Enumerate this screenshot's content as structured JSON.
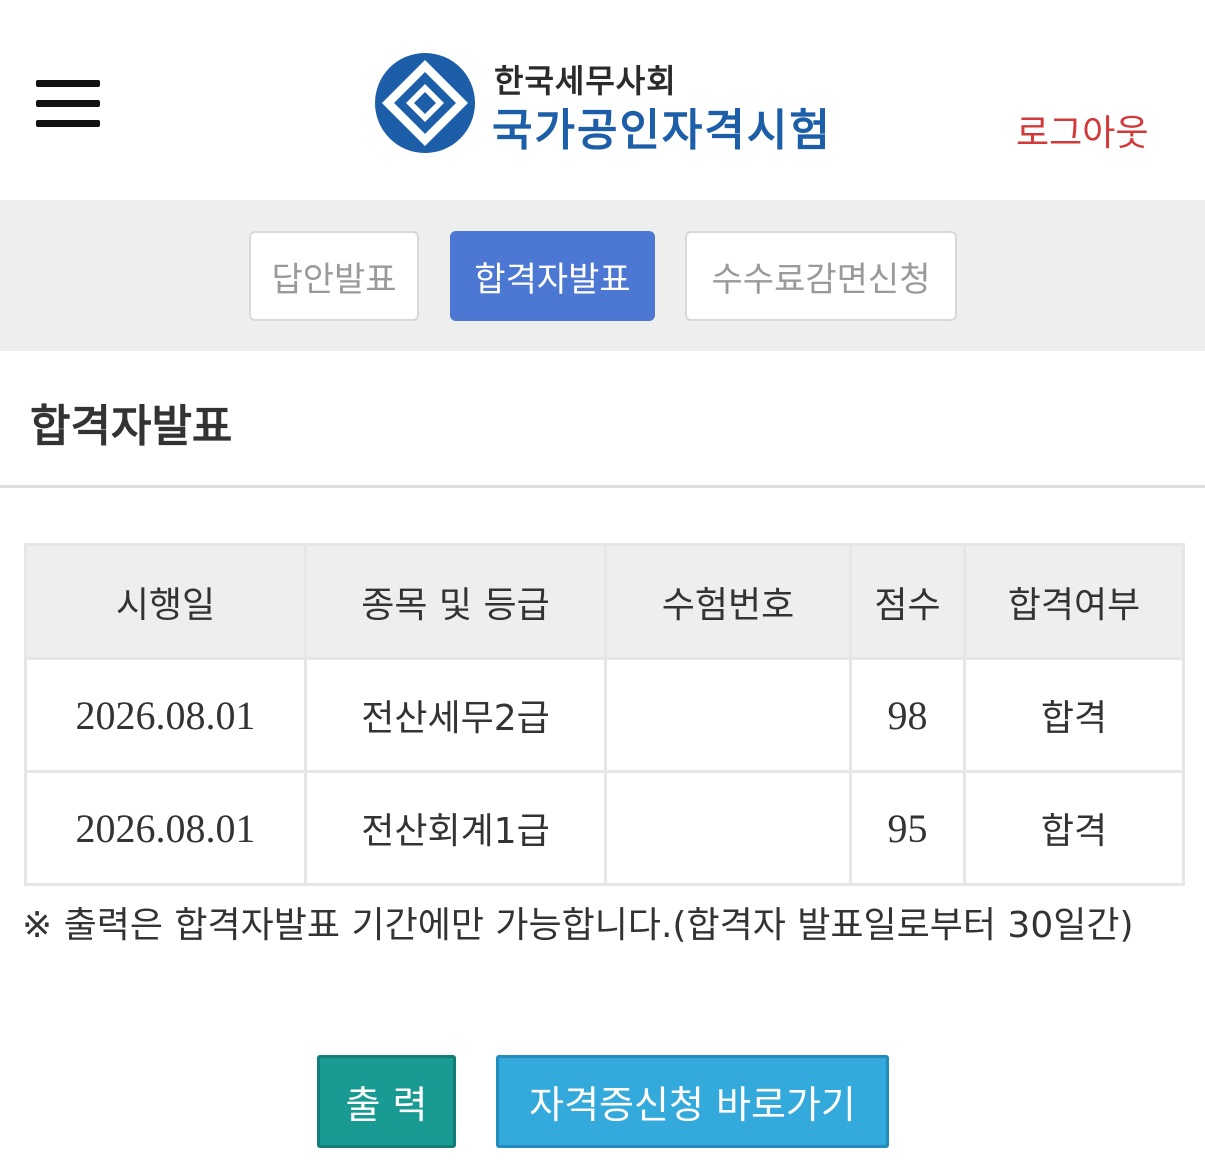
{
  "header": {
    "logo_org": "한국세무사회",
    "logo_title": "국가공인자격시험",
    "logout_label": "로그아웃",
    "menu_icon": "hamburger-menu-icon",
    "logo_icon": "diamond-emblem-icon"
  },
  "tabs": [
    {
      "label": "답안발표",
      "active": false
    },
    {
      "label": "합격자발표",
      "active": true
    },
    {
      "label": "수수료감면신청",
      "active": false
    }
  ],
  "page": {
    "title": "합격자발표"
  },
  "table": {
    "headers": [
      "시행일",
      "종목 및 등급",
      "수험번호",
      "점수",
      "합격여부"
    ],
    "rows": [
      {
        "date": "2026.08.01",
        "subject": "전산세무2급",
        "exam_no": "",
        "score": "98",
        "result": "합격"
      },
      {
        "date": "2026.08.01",
        "subject": "전산회계1급",
        "exam_no": "",
        "score": "95",
        "result": "합격"
      }
    ]
  },
  "notice": "※ 출력은 합격자발표 기간에만 가능합니다.(합격자 발표일로부터 30일간)",
  "buttons": {
    "print_label": "출 력",
    "cert_label": "자격증신청 바로가기"
  },
  "colors": {
    "brand_blue": "#1d5ea8",
    "active_tab": "#4c77d2",
    "logout_red": "#d23a3a",
    "print_button": "#199b93",
    "cert_button": "#33aadb"
  }
}
